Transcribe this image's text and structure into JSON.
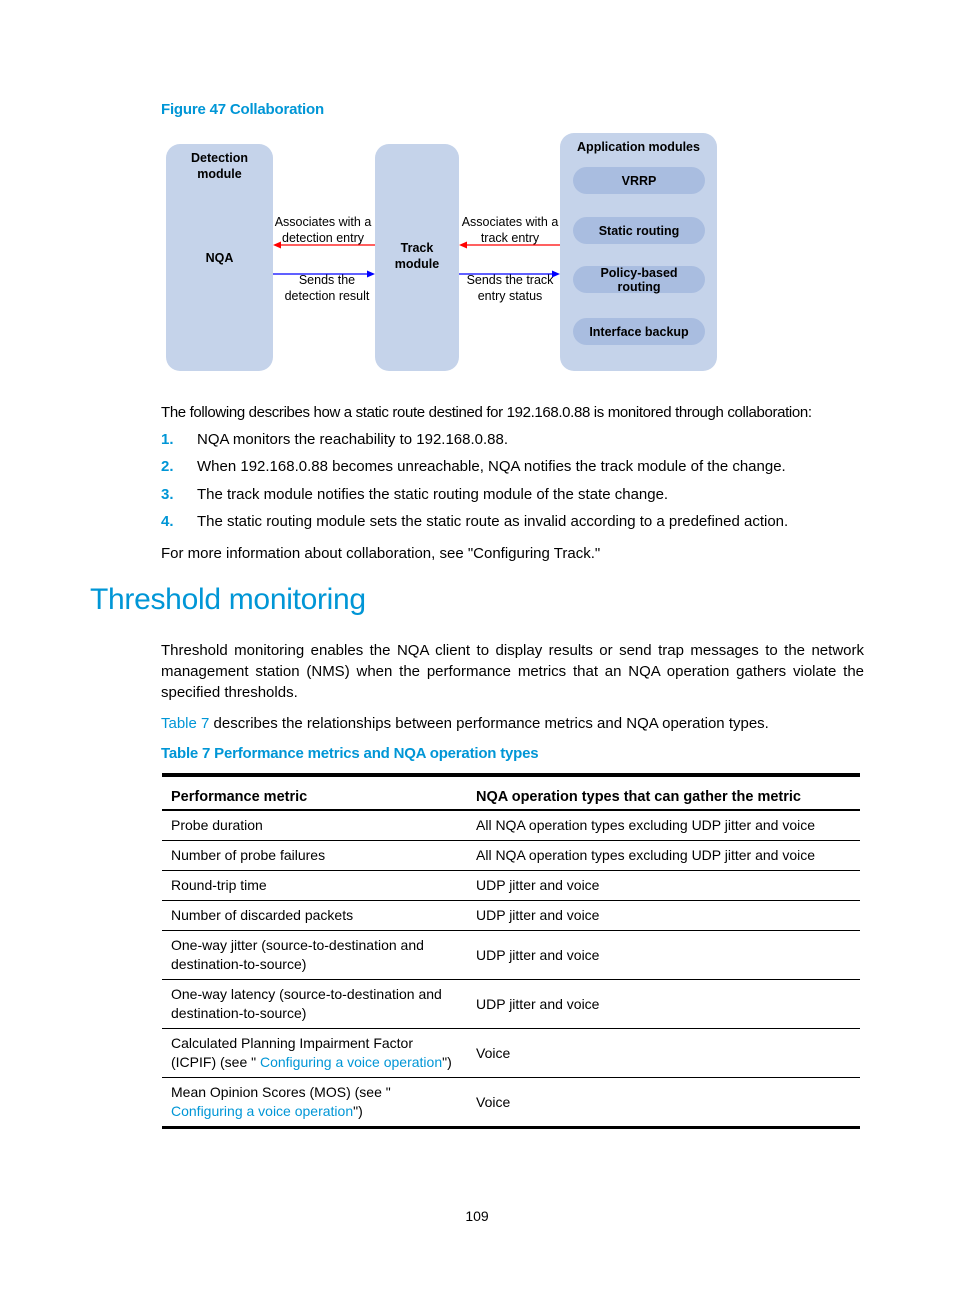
{
  "figure": {
    "caption": "Figure 47 Collaboration",
    "detection_module": {
      "title_line1": "Detection",
      "title_line2": "module",
      "content": "NQA"
    },
    "track_module": {
      "title_line1": "Track",
      "title_line2": "module"
    },
    "application_modules": {
      "title": "Application modules",
      "items": [
        "VRRP",
        "Static routing",
        "Policy-based routing",
        "Interface backup"
      ]
    },
    "arrows": {
      "left_top": {
        "line1": "Associates with a",
        "line2": "detection entry",
        "color": "#ff0000"
      },
      "left_bottom": {
        "line1": "Sends the",
        "line2": "detection result",
        "color": "#0000ff"
      },
      "right_top": {
        "line1": "Associates with a",
        "line2": "track entry",
        "color": "#ff0000"
      },
      "right_bottom": {
        "line1": "Sends the track",
        "line2": "entry status",
        "color": "#0000ff"
      }
    }
  },
  "intro": "The following describes how a static route destined for 192.168.0.88 is monitored through collaboration:",
  "steps": [
    {
      "num": "1.",
      "text": "NQA monitors the reachability to 192.168.0.88."
    },
    {
      "num": "2.",
      "text": "When 192.168.0.88 becomes unreachable, NQA notifies the track module of the change."
    },
    {
      "num": "3.",
      "text": "The track module notifies the static routing module of the state change."
    },
    {
      "num": "4.",
      "text": "The static routing module sets the static route as invalid according to a predefined action."
    }
  ],
  "more_info": "For more information about collaboration, see \"Configuring Track.\"",
  "section": {
    "heading": "Threshold monitoring",
    "paragraph": "Threshold monitoring enables the NQA client to display results or send trap messages to the network management station (NMS) when the performance metrics that an NQA operation gathers violate the specified thresholds.",
    "table_ref_link": "Table 7",
    "table_ref_rest": " describes the relationships between performance metrics and NQA operation types."
  },
  "table": {
    "caption": "Table 7 Performance metrics and NQA operation types",
    "headers": [
      "Performance metric",
      "NQA operation types that can gather the metric"
    ],
    "rows": [
      {
        "metric": "Probe duration",
        "types": "All NQA operation types excluding UDP jitter and voice"
      },
      {
        "metric": "Number of probe failures",
        "types": "All NQA operation types excluding UDP jitter and voice"
      },
      {
        "metric": "Round-trip time",
        "types": "UDP jitter and voice"
      },
      {
        "metric": "Number of discarded packets",
        "types": "UDP jitter and voice"
      },
      {
        "metric": "One-way jitter (source-to-destination and destination-to-source)",
        "types": "UDP jitter and voice"
      },
      {
        "metric": "One-way latency (source-to-destination and destination-to-source)",
        "types": "UDP jitter and voice"
      },
      {
        "metric_prefix": "Calculated Planning Impairment Factor (ICPIF) (see \"",
        "metric_link": " Configuring a voice operation",
        "metric_suffix": "\")",
        "types": "Voice"
      },
      {
        "metric_prefix": "Mean Opinion Scores (MOS) (see \"",
        "metric_link": " Configuring a voice operation",
        "metric_suffix": "\")",
        "types": "Voice"
      }
    ]
  },
  "page_number": "109",
  "colors": {
    "accent": "#0096d6",
    "box_fill": "#c5d3ea",
    "pill_fill": "#a9bde0"
  }
}
